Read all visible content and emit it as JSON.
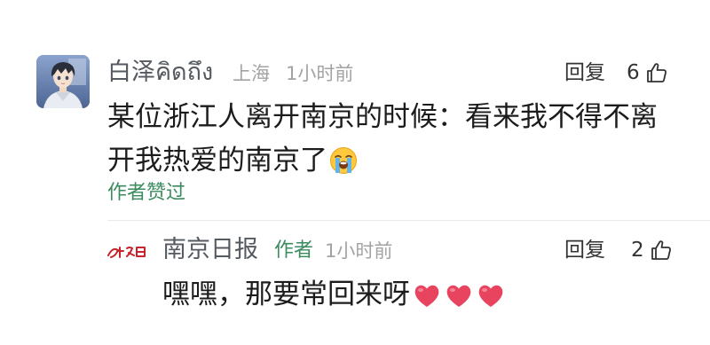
{
  "comment": {
    "author": "白泽คิดถึง",
    "location": "上海",
    "time": "1小时前",
    "reply_label": "回复",
    "like_count": "6",
    "text": "某位浙江人离开南京的时候：看来我不得不离开我热爱的南京了",
    "emoji": "loudly-crying-face",
    "author_liked": "作者赞过"
  },
  "reply": {
    "logo_text": "南京日报",
    "author": "南京日报",
    "author_tag": "作者",
    "time": "1小时前",
    "reply_label": "回复",
    "like_count": "2",
    "text": "嘿嘿，那要常回来呀",
    "emoji": [
      "heart",
      "heart",
      "heart"
    ]
  },
  "colors": {
    "name": "#555a60",
    "meta": "#a3a3a3",
    "accent_green": "#3a8b5d",
    "heart": "#e8445f",
    "logo_red": "#c9242b"
  }
}
